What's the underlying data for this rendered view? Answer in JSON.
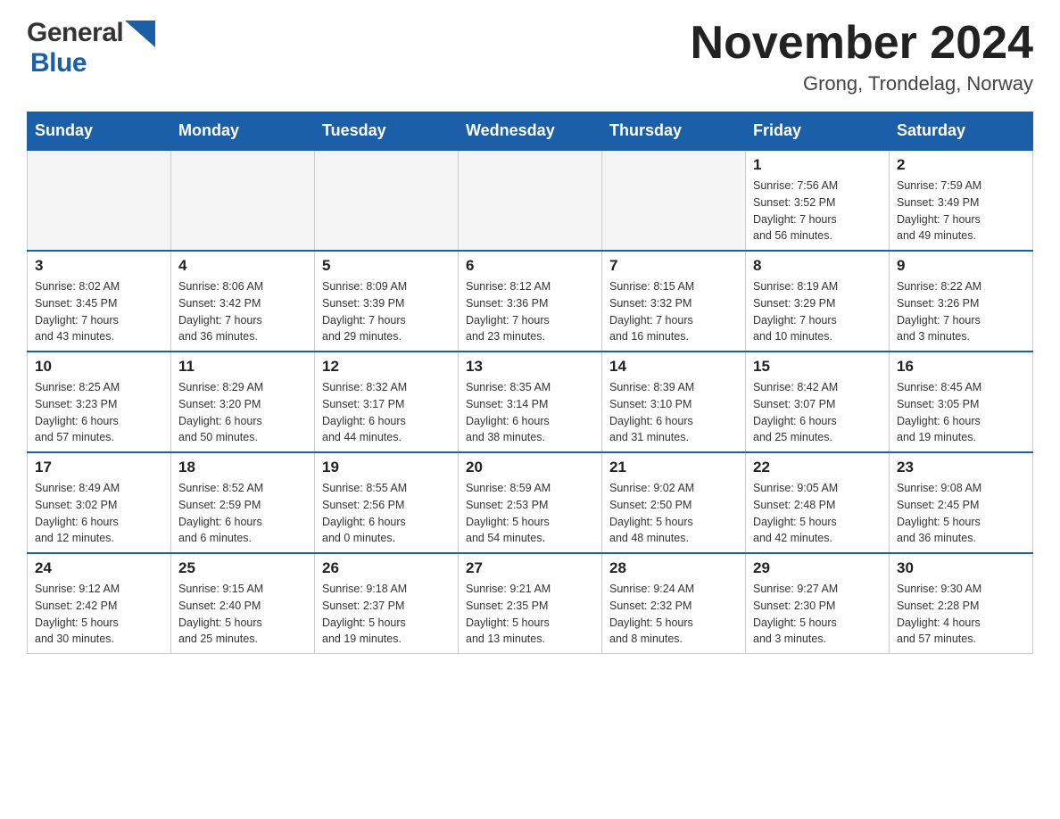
{
  "header": {
    "logo_general": "General",
    "logo_blue": "Blue",
    "month_title": "November 2024",
    "location": "Grong, Trondelag, Norway"
  },
  "days_of_week": [
    "Sunday",
    "Monday",
    "Tuesday",
    "Wednesday",
    "Thursday",
    "Friday",
    "Saturday"
  ],
  "weeks": [
    [
      {
        "day": "",
        "info": ""
      },
      {
        "day": "",
        "info": ""
      },
      {
        "day": "",
        "info": ""
      },
      {
        "day": "",
        "info": ""
      },
      {
        "day": "",
        "info": ""
      },
      {
        "day": "1",
        "info": "Sunrise: 7:56 AM\nSunset: 3:52 PM\nDaylight: 7 hours\nand 56 minutes."
      },
      {
        "day": "2",
        "info": "Sunrise: 7:59 AM\nSunset: 3:49 PM\nDaylight: 7 hours\nand 49 minutes."
      }
    ],
    [
      {
        "day": "3",
        "info": "Sunrise: 8:02 AM\nSunset: 3:45 PM\nDaylight: 7 hours\nand 43 minutes."
      },
      {
        "day": "4",
        "info": "Sunrise: 8:06 AM\nSunset: 3:42 PM\nDaylight: 7 hours\nand 36 minutes."
      },
      {
        "day": "5",
        "info": "Sunrise: 8:09 AM\nSunset: 3:39 PM\nDaylight: 7 hours\nand 29 minutes."
      },
      {
        "day": "6",
        "info": "Sunrise: 8:12 AM\nSunset: 3:36 PM\nDaylight: 7 hours\nand 23 minutes."
      },
      {
        "day": "7",
        "info": "Sunrise: 8:15 AM\nSunset: 3:32 PM\nDaylight: 7 hours\nand 16 minutes."
      },
      {
        "day": "8",
        "info": "Sunrise: 8:19 AM\nSunset: 3:29 PM\nDaylight: 7 hours\nand 10 minutes."
      },
      {
        "day": "9",
        "info": "Sunrise: 8:22 AM\nSunset: 3:26 PM\nDaylight: 7 hours\nand 3 minutes."
      }
    ],
    [
      {
        "day": "10",
        "info": "Sunrise: 8:25 AM\nSunset: 3:23 PM\nDaylight: 6 hours\nand 57 minutes."
      },
      {
        "day": "11",
        "info": "Sunrise: 8:29 AM\nSunset: 3:20 PM\nDaylight: 6 hours\nand 50 minutes."
      },
      {
        "day": "12",
        "info": "Sunrise: 8:32 AM\nSunset: 3:17 PM\nDaylight: 6 hours\nand 44 minutes."
      },
      {
        "day": "13",
        "info": "Sunrise: 8:35 AM\nSunset: 3:14 PM\nDaylight: 6 hours\nand 38 minutes."
      },
      {
        "day": "14",
        "info": "Sunrise: 8:39 AM\nSunset: 3:10 PM\nDaylight: 6 hours\nand 31 minutes."
      },
      {
        "day": "15",
        "info": "Sunrise: 8:42 AM\nSunset: 3:07 PM\nDaylight: 6 hours\nand 25 minutes."
      },
      {
        "day": "16",
        "info": "Sunrise: 8:45 AM\nSunset: 3:05 PM\nDaylight: 6 hours\nand 19 minutes."
      }
    ],
    [
      {
        "day": "17",
        "info": "Sunrise: 8:49 AM\nSunset: 3:02 PM\nDaylight: 6 hours\nand 12 minutes."
      },
      {
        "day": "18",
        "info": "Sunrise: 8:52 AM\nSunset: 2:59 PM\nDaylight: 6 hours\nand 6 minutes."
      },
      {
        "day": "19",
        "info": "Sunrise: 8:55 AM\nSunset: 2:56 PM\nDaylight: 6 hours\nand 0 minutes."
      },
      {
        "day": "20",
        "info": "Sunrise: 8:59 AM\nSunset: 2:53 PM\nDaylight: 5 hours\nand 54 minutes."
      },
      {
        "day": "21",
        "info": "Sunrise: 9:02 AM\nSunset: 2:50 PM\nDaylight: 5 hours\nand 48 minutes."
      },
      {
        "day": "22",
        "info": "Sunrise: 9:05 AM\nSunset: 2:48 PM\nDaylight: 5 hours\nand 42 minutes."
      },
      {
        "day": "23",
        "info": "Sunrise: 9:08 AM\nSunset: 2:45 PM\nDaylight: 5 hours\nand 36 minutes."
      }
    ],
    [
      {
        "day": "24",
        "info": "Sunrise: 9:12 AM\nSunset: 2:42 PM\nDaylight: 5 hours\nand 30 minutes."
      },
      {
        "day": "25",
        "info": "Sunrise: 9:15 AM\nSunset: 2:40 PM\nDaylight: 5 hours\nand 25 minutes."
      },
      {
        "day": "26",
        "info": "Sunrise: 9:18 AM\nSunset: 2:37 PM\nDaylight: 5 hours\nand 19 minutes."
      },
      {
        "day": "27",
        "info": "Sunrise: 9:21 AM\nSunset: 2:35 PM\nDaylight: 5 hours\nand 13 minutes."
      },
      {
        "day": "28",
        "info": "Sunrise: 9:24 AM\nSunset: 2:32 PM\nDaylight: 5 hours\nand 8 minutes."
      },
      {
        "day": "29",
        "info": "Sunrise: 9:27 AM\nSunset: 2:30 PM\nDaylight: 5 hours\nand 3 minutes."
      },
      {
        "day": "30",
        "info": "Sunrise: 9:30 AM\nSunset: 2:28 PM\nDaylight: 4 hours\nand 57 minutes."
      }
    ]
  ]
}
